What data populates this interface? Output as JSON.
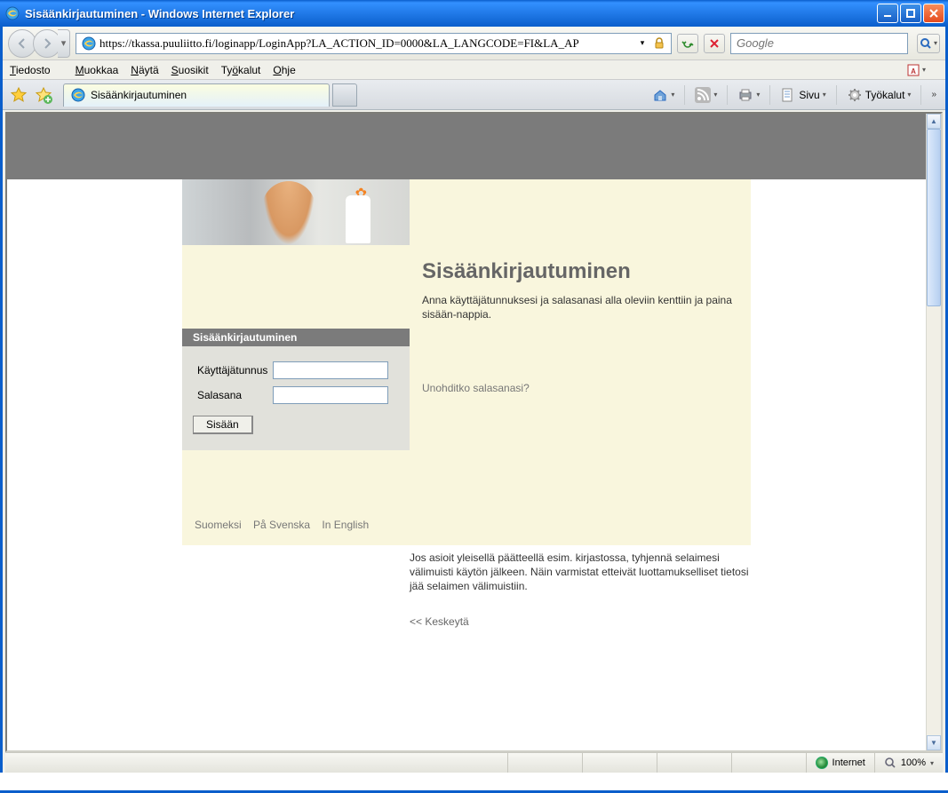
{
  "window": {
    "title": "Sisäänkirjautuminen - Windows Internet Explorer"
  },
  "addressbar": {
    "url": "https://tkassa.puuliitto.fi/loginapp/LoginApp?LA_ACTION_ID=0000&LA_LANGCODE=FI&LA_AP"
  },
  "searchbox": {
    "placeholder": "Google"
  },
  "menus": {
    "file": "Tiedosto",
    "edit": "Muokkaa",
    "view": "Näytä",
    "favorites": "Suosikit",
    "tools": "Työkalut",
    "help": "Ohje"
  },
  "tab": {
    "title": "Sisäänkirjautuminen"
  },
  "toolbar": {
    "page": "Sivu",
    "tools": "Työkalut"
  },
  "login": {
    "heading": "Sisäänkirjautuminen",
    "intro": "Anna käyttäjätunnuksesi ja salasanasi alla oleviin kenttiin ja paina sisään-nappia.",
    "box_header": "Sisäänkirjautuminen",
    "user_label": "Käyttäjätunnus",
    "pass_label": "Salasana",
    "submit": "Sisään",
    "forgot": "Unohditko salasanasi?",
    "langs": {
      "fi": "Suomeksi",
      "sv": "På Svenska",
      "en": "In English"
    },
    "notice": "Jos asioit yleisellä päätteellä esim. kirjastossa, tyhjennä selaimesi välimuisti käytön jälkeen. Näin varmistat etteivät luottamukselliset tietosi jää selaimen välimuistiin.",
    "cancel": "<< Keskeytä"
  },
  "statusbar": {
    "zone": "Internet",
    "zoom": "100%"
  }
}
